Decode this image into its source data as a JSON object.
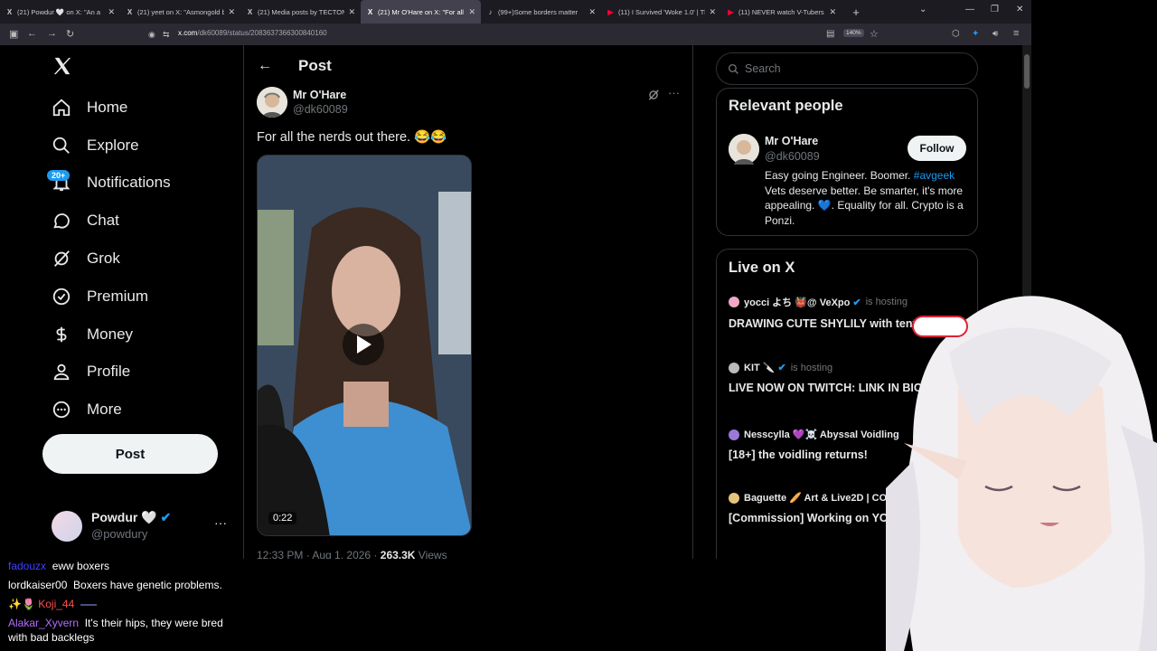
{
  "tabs": [
    {
      "title": "(21) Powdur 🤍 on X: \"An a",
      "fav": "X",
      "active": false
    },
    {
      "title": "(21) yeet on X: \"Asmongold bui",
      "fav": "X",
      "active": false
    },
    {
      "title": "(21) Media posts by TECTONE",
      "fav": "X",
      "active": false
    },
    {
      "title": "(21) Mr O'Hare on X: \"For all th",
      "fav": "X",
      "active": true
    },
    {
      "title": "(99+)Some borders matter",
      "fav": "♪",
      "active": false
    },
    {
      "title": "(11) I Survived 'Woke 1.0' | The",
      "fav": "▶",
      "active": false
    },
    {
      "title": "(11) NEVER watch V-Tubers - Y",
      "fav": "▶",
      "active": false
    }
  ],
  "url": {
    "host": "x.com",
    "path": "/dk60089/status/2083637366300840160"
  },
  "zoom": "140%",
  "nav": {
    "items": [
      {
        "label": "Home"
      },
      {
        "label": "Explore"
      },
      {
        "label": "Notifications"
      },
      {
        "label": "Chat"
      },
      {
        "label": "Grok"
      },
      {
        "label": "Premium"
      },
      {
        "label": "Money"
      },
      {
        "label": "Profile"
      },
      {
        "label": "More"
      }
    ],
    "notif_badge": "20+",
    "post_label": "Post"
  },
  "account": {
    "name": "Powdur 🤍",
    "handle": "@powdury"
  },
  "post": {
    "header": "Post",
    "author_name": "Mr O'Hare",
    "author_handle": "@dk60089",
    "text": "For all the nerds out there. 😂😂",
    "video_time": "0:22",
    "time": "12:33 PM · Aug 1, 2026 · ",
    "views": "263.3K",
    "views_label": " Views"
  },
  "search": {
    "placeholder": "Search"
  },
  "relevant": {
    "title": "Relevant people",
    "name": "Mr O'Hare",
    "handle": "@dk60089",
    "follow": "Follow",
    "bio_a": "Easy going Engineer. Boomer. ",
    "bio_tag": "#avgeek",
    "bio_b": " Vets deserve better. Be smarter, it's more appealing. 💙. Equality for all. Crypto is a Ponzi."
  },
  "live": {
    "title": "Live on X",
    "items": [
      {
        "host": "yocci よち 👹@ VeXpo",
        "hosting": "is hosting",
        "desc": "DRAWING CUTE SHYLILY with tentacles :) ~",
        "dot": "#f2a6c8"
      },
      {
        "host": "KIT 🔪",
        "hosting": "is hosting",
        "desc": "LIVE NOW ON TWITCH: LINK IN BIO",
        "dot": "#bbbbbb"
      },
      {
        "host": "Nesscylla 💜☠️ Abyssal Voidling",
        "hosting": "",
        "desc": "[18+] the voidling returns!",
        "dot": "#9a7ad6"
      },
      {
        "host": "Baguette 🥖 Art & Live2D | COM...",
        "hosting": "",
        "desc": "[Commission] Working on YCH Chibi model!",
        "dot": "#e6c37a"
      }
    ]
  },
  "chat": [
    {
      "user": "fadouzx",
      "msg": "eww boxers",
      "color": "#4040ff"
    },
    {
      "user": "lordkaiser00",
      "msg": "Boxers have genetic problems.",
      "color": "#ffffff"
    },
    {
      "user": "Koji_44",
      "msg": "",
      "color": "#ff4d4d"
    },
    {
      "user": "Alakar_Xyvern",
      "msg": "It's their hips, they were bred with bad backlegs",
      "color": "#b56cff"
    }
  ]
}
